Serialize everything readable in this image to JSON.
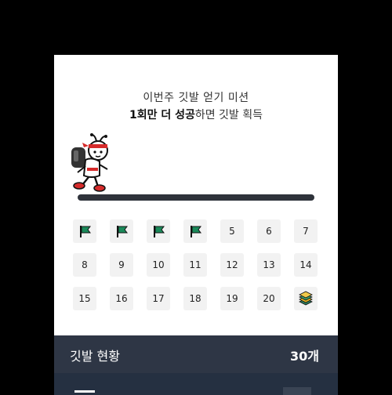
{
  "mission": {
    "title": "이번주 깃발 얻기 미션",
    "subtitle_count": "1회만 더 성공",
    "subtitle_rest": "하면 깃발 획득"
  },
  "progress": {
    "value": 1.0
  },
  "days": [
    {
      "label": "",
      "state": "flag"
    },
    {
      "label": "",
      "state": "flag"
    },
    {
      "label": "",
      "state": "flag"
    },
    {
      "label": "",
      "state": "flag"
    },
    {
      "label": "5",
      "state": "number"
    },
    {
      "label": "6",
      "state": "number"
    },
    {
      "label": "7",
      "state": "number"
    },
    {
      "label": "8",
      "state": "number"
    },
    {
      "label": "9",
      "state": "number"
    },
    {
      "label": "10",
      "state": "number"
    },
    {
      "label": "11",
      "state": "number"
    },
    {
      "label": "12",
      "state": "number"
    },
    {
      "label": "13",
      "state": "number"
    },
    {
      "label": "14",
      "state": "number"
    },
    {
      "label": "15",
      "state": "number"
    },
    {
      "label": "16",
      "state": "number"
    },
    {
      "label": "17",
      "state": "number"
    },
    {
      "label": "18",
      "state": "number"
    },
    {
      "label": "19",
      "state": "number"
    },
    {
      "label": "20",
      "state": "number"
    },
    {
      "label": "",
      "state": "reward"
    }
  ],
  "status": {
    "label": "깃발 현황",
    "count": "30개"
  },
  "colors": {
    "flag": "#1a8a5a",
    "status_bg": "#2e3645",
    "progress": "#2f333b"
  }
}
